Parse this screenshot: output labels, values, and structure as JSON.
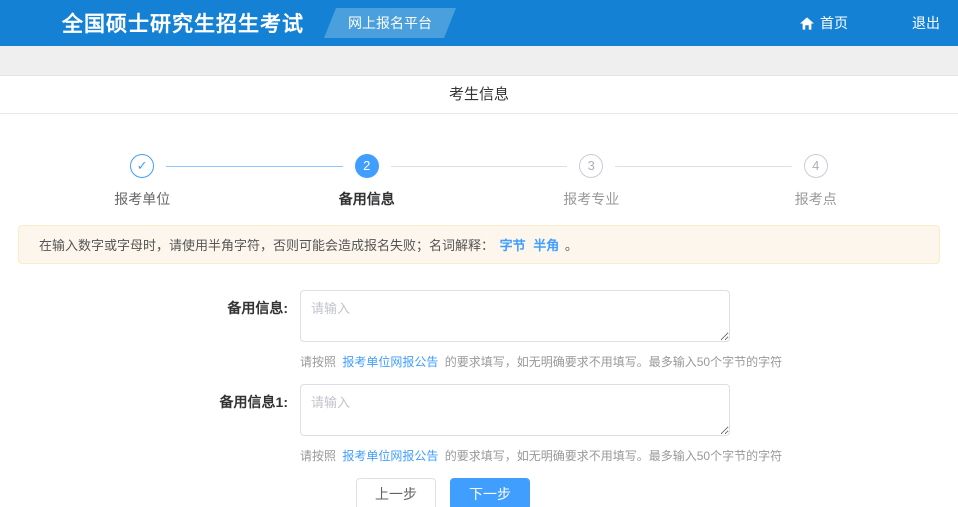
{
  "header": {
    "title": "全国硕士研究生招生考试",
    "badge": "网上报名平台",
    "home_label": "首页",
    "logout_label": "退出"
  },
  "page": {
    "section_title": "考生信息"
  },
  "stepper": {
    "steps": [
      {
        "symbol": "✓",
        "label": "报考单位",
        "state": "done"
      },
      {
        "symbol": "2",
        "label": "备用信息",
        "state": "active"
      },
      {
        "symbol": "3",
        "label": "报考专业",
        "state": "pending"
      },
      {
        "symbol": "4",
        "label": "报考点",
        "state": "pending"
      }
    ]
  },
  "notice": {
    "text": "在输入数字或字母时，请使用半角字符，否则可能会造成报名失败；名词解释：",
    "link_byte": "字节",
    "link_halfwidth": "半角",
    "suffix": "。"
  },
  "form": {
    "fields": [
      {
        "label": "备用信息:",
        "placeholder": "请输入",
        "help_prefix": "请按照",
        "help_link": "报考单位网报公告",
        "help_suffix": "的要求填写，如无明确要求不用填写。最多输入50个字节的字符"
      },
      {
        "label": "备用信息1:",
        "placeholder": "请输入",
        "help_prefix": "请按照",
        "help_link": "报考单位网报公告",
        "help_suffix": "的要求填写，如无明确要求不用填写。最多输入50个字节的字符"
      }
    ],
    "prev_label": "上一步",
    "next_label": "下一步"
  },
  "colors": {
    "header_blue": "#1581d4",
    "badge_blue": "#4a9fdd",
    "accent_blue": "#409eff",
    "notice_bg": "#fdf6ec",
    "notice_border": "#faecc8"
  }
}
